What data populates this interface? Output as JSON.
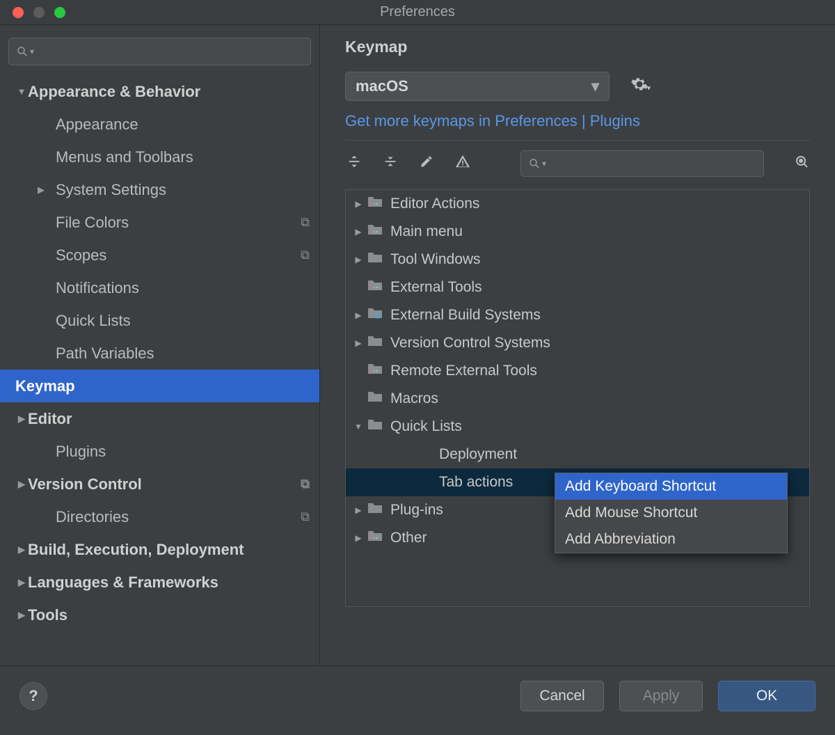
{
  "window": {
    "title": "Preferences"
  },
  "sidebar": {
    "search_placeholder": "",
    "items": [
      {
        "label": "Appearance & Behavior",
        "level": 0,
        "arrow": "down"
      },
      {
        "label": "Appearance",
        "level": 1
      },
      {
        "label": "Menus and Toolbars",
        "level": 1
      },
      {
        "label": "System Settings",
        "level": 1,
        "arrow": "right"
      },
      {
        "label": "File Colors",
        "level": 1,
        "badge": "⧉"
      },
      {
        "label": "Scopes",
        "level": 1,
        "badge": "⧉"
      },
      {
        "label": "Notifications",
        "level": 1
      },
      {
        "label": "Quick Lists",
        "level": 1
      },
      {
        "label": "Path Variables",
        "level": 1
      },
      {
        "label": "Keymap",
        "level": 0,
        "selected": true
      },
      {
        "label": "Editor",
        "level": 0,
        "arrow": "right"
      },
      {
        "label": "Plugins",
        "level": 1
      },
      {
        "label": "Version Control",
        "level": 0,
        "arrow": "right",
        "badge": "⧉"
      },
      {
        "label": "Directories",
        "level": 1,
        "badge": "⧉"
      },
      {
        "label": "Build, Execution, Deployment",
        "level": 0,
        "arrow": "right"
      },
      {
        "label": "Languages & Frameworks",
        "level": 0,
        "arrow": "right"
      },
      {
        "label": "Tools",
        "level": 0,
        "arrow": "right"
      }
    ]
  },
  "main": {
    "heading": "Keymap",
    "scheme": "macOS",
    "link_text": "Get more keymaps in Preferences | Plugins",
    "action_search_placeholder": "",
    "actions": [
      {
        "label": "Editor Actions",
        "arrow": "right",
        "icon": "folder-color"
      },
      {
        "label": "Main menu",
        "arrow": "right",
        "icon": "folder-color"
      },
      {
        "label": "Tool Windows",
        "arrow": "right",
        "icon": "folder"
      },
      {
        "label": "External Tools",
        "icon": "folder-color"
      },
      {
        "label": "External Build Systems",
        "arrow": "right",
        "icon": "folder-gear"
      },
      {
        "label": "Version Control Systems",
        "arrow": "right",
        "icon": "folder"
      },
      {
        "label": "Remote External Tools",
        "icon": "folder-color"
      },
      {
        "label": "Macros",
        "icon": "folder"
      },
      {
        "label": "Quick Lists",
        "arrow": "down",
        "icon": "folder"
      },
      {
        "label": "Deployment",
        "depth": 2
      },
      {
        "label": "Tab actions",
        "depth": 2,
        "highlighted": true
      },
      {
        "label": "Plug-ins",
        "arrow": "right",
        "icon": "folder"
      },
      {
        "label": "Other",
        "arrow": "right",
        "icon": "folder-color"
      }
    ],
    "context_menu": [
      {
        "label": "Add Keyboard Shortcut",
        "highlighted": true
      },
      {
        "label": "Add Mouse Shortcut"
      },
      {
        "label": "Add Abbreviation"
      }
    ]
  },
  "footer": {
    "cancel": "Cancel",
    "apply": "Apply",
    "ok": "OK"
  }
}
